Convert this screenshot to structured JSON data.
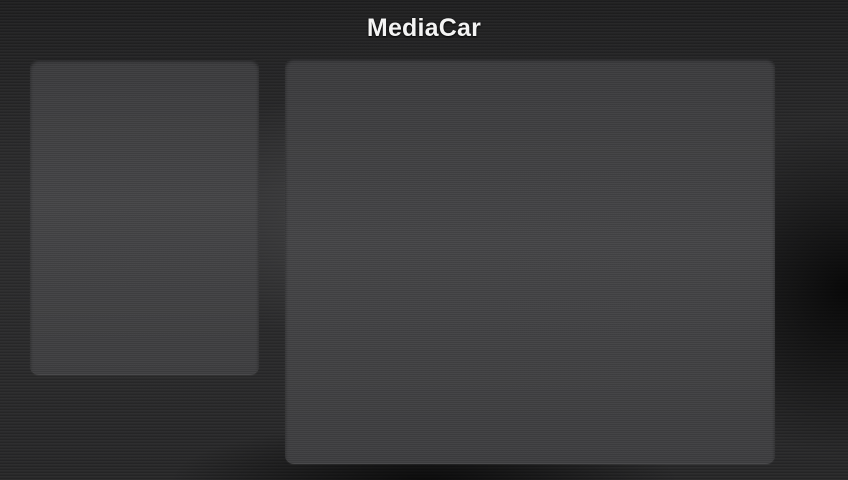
{
  "app": {
    "title": "MediaCar"
  },
  "panels": {
    "left": {
      "role": "side-panel"
    },
    "right": {
      "role": "main-panel"
    }
  },
  "colors": {
    "background": "#2a2a2b",
    "panel": "#414143",
    "title_text": "#f4f4f4"
  }
}
